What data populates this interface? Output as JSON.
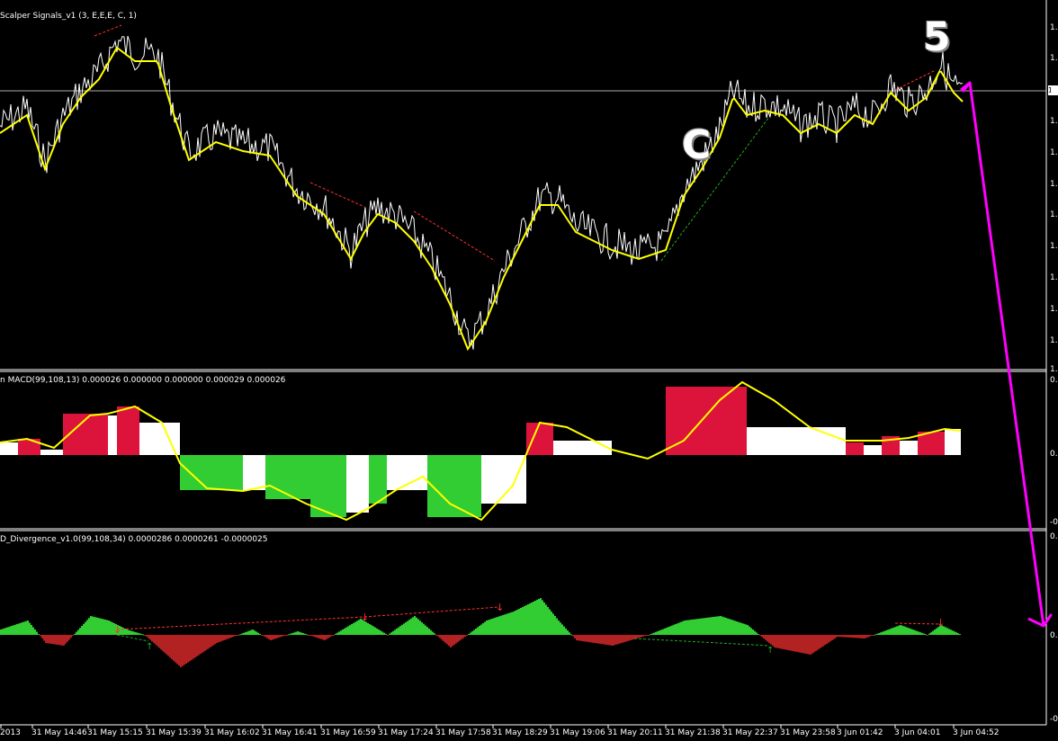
{
  "indicators": {
    "main_label": "Scalper Signals_v1 (3, E,E,E, C, 1)",
    "macd_label": "n MACD(99,108,13) 0.000026 0.000000 0.000000 0.000029 0.000026",
    "div_label": "D_Divergence_v1.0(99,108,34) 0.0000286 0.0000261 -0.0000025"
  },
  "annotations": {
    "wave_c": "C",
    "wave_5": "5"
  },
  "price_axis": {
    "main_ticks": [
      "1.",
      "1.",
      "1.",
      "1.",
      "1.",
      "1.",
      "1.",
      "1.",
      "1.",
      "1.",
      "1.",
      "1.",
      "1.",
      "1."
    ],
    "current_price": "1",
    "macd_ticks": [
      "0.0",
      "0.0",
      "-0."
    ],
    "div_ticks": [
      "0.0",
      "0.0",
      "-0.0"
    ]
  },
  "time_axis": [
    "2013",
    "31 May 14:46",
    "31 May 15:15",
    "31 May 15:39",
    "31 May 16:02",
    "31 May 16:41",
    "31 May 16:59",
    "31 May 17:24",
    "31 May 17:58",
    "31 May 18:29",
    "31 May 19:06",
    "31 May 20:11",
    "31 May 21:38",
    "31 May 22:37",
    "31 May 23:58",
    "3 Jun 01:42",
    "3 Jun 04:01",
    "3 Jun 04:52"
  ],
  "colors": {
    "background": "#000000",
    "price_line": "#ffffff",
    "ma_line": "#ffff00",
    "macd_up": "#dc143c",
    "macd_down": "#32cd32",
    "macd_neutral": "#ffffff",
    "div_up": "#32cd32",
    "div_down": "#b22222",
    "projection_arrow": "#ff00ff"
  }
}
